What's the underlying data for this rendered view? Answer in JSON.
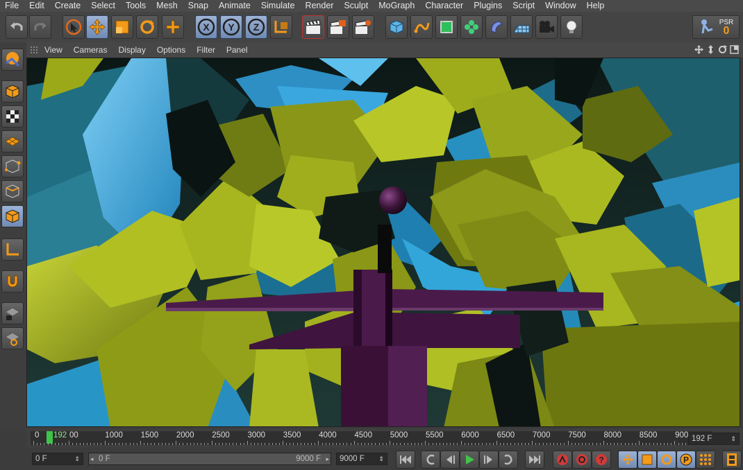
{
  "menu": [
    "File",
    "Edit",
    "Create",
    "Select",
    "Tools",
    "Mesh",
    "Snap",
    "Animate",
    "Simulate",
    "Render",
    "Sculpt",
    "MoGraph",
    "Character",
    "Plugins",
    "Script",
    "Window",
    "Help"
  ],
  "toolbar": {
    "undo": "undo-icon",
    "redo": "redo-icon",
    "axis_x": "X",
    "axis_y": "Y",
    "axis_z": "Z",
    "psr_label": "PSR",
    "psr_value": "0"
  },
  "viewport_menu": [
    "View",
    "Cameras",
    "Display",
    "Options",
    "Filter",
    "Panel"
  ],
  "timeline": {
    "start": "0",
    "current": "192",
    "ticks": [
      "00",
      "1000",
      "1500",
      "2000",
      "2500",
      "3000",
      "3500",
      "4000",
      "4500",
      "5000",
      "5500",
      "6000",
      "6500",
      "7000",
      "7500",
      "8000",
      "8500",
      "900"
    ],
    "current_frame_field": "192 F"
  },
  "transport": {
    "start_field": "0 F",
    "range_start": "0 F",
    "range_end": "9000 F",
    "end_field": "9000 F"
  },
  "colors": {
    "accent": "#8aa6d1",
    "play": "#3fc44a",
    "record": "#d23a3a"
  }
}
